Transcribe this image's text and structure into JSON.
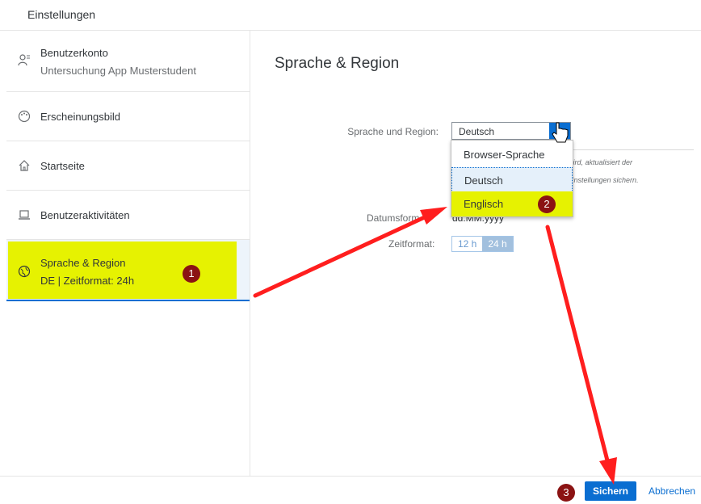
{
  "header": {
    "title": "Einstellungen"
  },
  "sidebar": {
    "items": [
      {
        "label": "Benutzerkonto",
        "sub": "Untersuchung App Musterstudent",
        "icon": "user-account-icon"
      },
      {
        "label": "Erscheinungsbild",
        "icon": "palette-icon"
      },
      {
        "label": "Startseite",
        "icon": "home-icon"
      },
      {
        "label": "Benutzeraktivitäten",
        "icon": "laptop-icon"
      },
      {
        "label": "Sprache & Region",
        "sub": "DE | Zeitformat: 24h",
        "icon": "globe-icon"
      }
    ]
  },
  "main": {
    "title": "Sprache & Region",
    "language_label": "Sprache und Region:",
    "language_value": "Deutsch",
    "hint_line1": "iert wird, aktualisiert der",
    "hint_line2": "die Einstellungen sichern.",
    "date_label": "Datumsform",
    "date_value": "dd.MM.yyyy",
    "time_label": "Zeitformat:",
    "time_options": [
      "12 h",
      "24 h"
    ],
    "time_selected": "24 h"
  },
  "dropdown": {
    "options": [
      "Browser-Sprache",
      "Deutsch",
      "Englisch"
    ]
  },
  "footer": {
    "save_label": "Sichern",
    "cancel_label": "Abbrechen"
  },
  "annotations": {
    "badges": [
      "1",
      "2",
      "3"
    ],
    "highlight_color": "#e6f201",
    "badge_color": "#8b1313",
    "arrow_color": "#ff1e1e"
  },
  "colors": {
    "accent": "#0a6ed1"
  }
}
